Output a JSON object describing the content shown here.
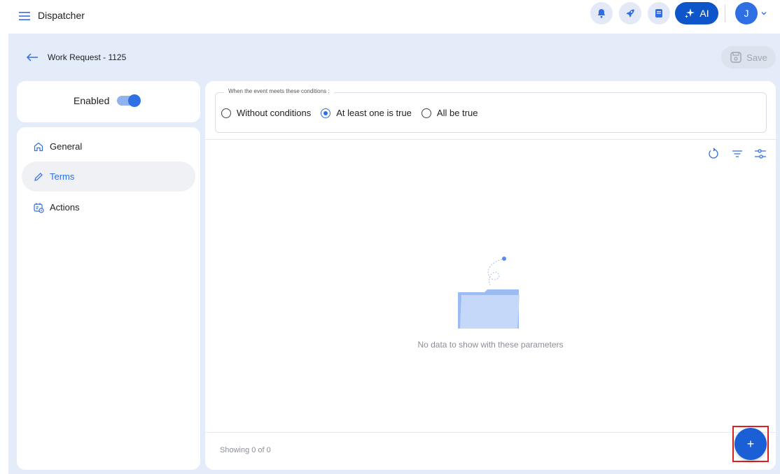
{
  "header": {
    "app_title": "Dispatcher",
    "ai_label": "AI",
    "avatar_initial": "J"
  },
  "toolbar": {
    "page_title": "Work Request - 1125",
    "save_label": "Save"
  },
  "status": {
    "enabled_label": "Enabled",
    "enabled": true
  },
  "sidebar": {
    "items": [
      {
        "label": "General",
        "icon": "home-icon",
        "active": false
      },
      {
        "label": "Terms",
        "icon": "pencil-icon",
        "active": true
      },
      {
        "label": "Actions",
        "icon": "calendar-action-icon",
        "active": false
      }
    ]
  },
  "conditions": {
    "legend": "When the event meets these conditions :",
    "options": [
      {
        "label": "Without conditions",
        "checked": false
      },
      {
        "label": "At least one is true",
        "checked": true
      },
      {
        "label": "All be true",
        "checked": false
      }
    ]
  },
  "empty_state": {
    "message": "No data to show with these parameters"
  },
  "footer": {
    "showing": "Showing 0 of 0"
  },
  "fab": {
    "label": "+"
  },
  "colors": {
    "accent": "#2f6fe4",
    "workspace_bg": "#e4ecf9",
    "highlight": "#e0201f"
  }
}
